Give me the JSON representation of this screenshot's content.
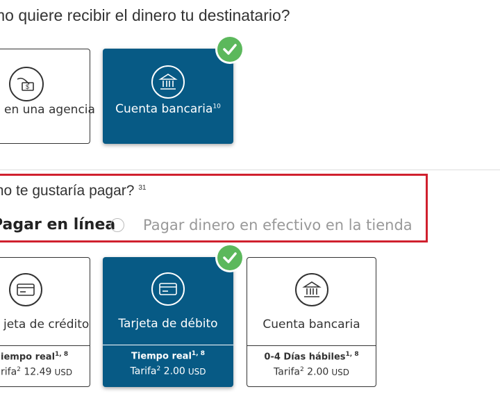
{
  "delivery": {
    "question": "mo quiere recibir el dinero tu destinatario?",
    "options": [
      {
        "label": "en una agencia",
        "selected": false,
        "icon": "cash-pickup-icon"
      },
      {
        "label": "Cuenta bancaria",
        "sup": "10",
        "selected": true,
        "icon": "bank-icon"
      }
    ]
  },
  "payment": {
    "question": "mo te gustaría pagar?",
    "question_sup": "31",
    "online_label": "Pagar en línea",
    "cash_label": "Pagar dinero en efectivo en la tienda"
  },
  "methods": [
    {
      "label": "jeta de crédito",
      "time": "iempo real",
      "time_sup": "1, 8",
      "fee_prefix": "rifa",
      "fee_sup": "2",
      "fee": "12.49",
      "currency": "USD",
      "selected": false,
      "icon": "credit-card-icon"
    },
    {
      "label": "Tarjeta de débito",
      "time": "Tiempo real",
      "time_sup": "1, 8",
      "fee_prefix": "Tarifa",
      "fee_sup": "2",
      "fee": "2.00",
      "currency": "USD",
      "selected": true,
      "icon": "debit-card-icon"
    },
    {
      "label": "Cuenta bancaria",
      "time": "0-4 Días hábiles",
      "time_sup": "1, 8",
      "fee_prefix": "Tarifa",
      "fee_sup": "2",
      "fee": "2.00",
      "currency": "USD",
      "selected": false,
      "icon": "bank-icon"
    }
  ],
  "colors": {
    "selected_bg": "#075a85",
    "check_green": "#5cb85c",
    "highlight_red": "#d0202e"
  }
}
